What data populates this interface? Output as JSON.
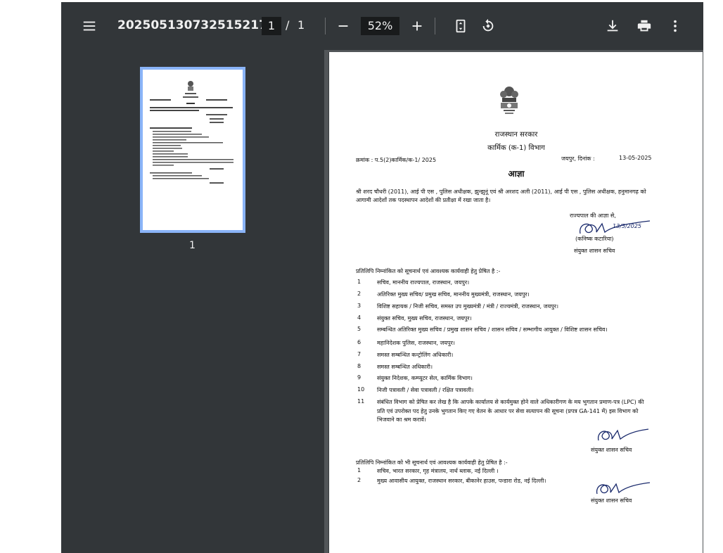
{
  "toolbar": {
    "menu_icon": "hamburger-menu-icon",
    "title": "202505130732515217...",
    "current_page": "1",
    "page_sep": "/",
    "total_pages": "1",
    "zoom": "52%",
    "zoom_out_icon": "minus-icon",
    "zoom_in_icon": "plus-icon",
    "fit_icon": "fit-page-icon",
    "rotate_icon": "rotate-icon",
    "download_icon": "download-icon",
    "print_icon": "print-icon",
    "more_icon": "more-vert-icon",
    "colors": {
      "bar": "#323639",
      "box": "#191b1c",
      "text": "#f1f1f1"
    }
  },
  "sidebar": {
    "thumbnails": [
      {
        "label": "1",
        "selected": true
      }
    ],
    "accent": "#8ab4f8"
  },
  "document": {
    "header_gov": "राजस्थान सरकार",
    "header_dept": "कार्मिक (क-1) विभाग",
    "ref_no": "क्रमांक : प.5(2)कार्मिक/क-1/ 2025",
    "place_date_label": "जयपुर, दिनांक :",
    "date": "13-05-2025",
    "order_title": "आज्ञा",
    "body_line1": "श्री शरद चौधरी (2011), आई पी एस , पुलिस अधीक्षक, झुन्झुनूं एवं श्री अरशद अली (2011), आई पी एस , पुलिस अधीक्षक, हनुमानगढ़ को",
    "body_line2": "आगामी आदेशों तक पदस्थापन आदेशों की प्रतीक्षा में रखा जाता है।",
    "governor_order": "राज्यपाल की आज्ञा से,",
    "signer_name": "(कनिष्क कटारिया)",
    "signer_title": "संयुक्त शासन सचिव",
    "signature_date": "13/5/2025",
    "copy_intro": "प्रतिलिपि निम्नांकित को सूचनार्थ एवं आवश्यक कार्यवाही हेतु प्रेषित है :-",
    "copy_list": [
      {
        "n": "1",
        "text": "सचिव, माननीय राज्यपाल, राजस्थान, जयपुर।"
      },
      {
        "n": "2",
        "text": "अतिरिक्त मुख्य सचिव/ प्रमुख सचिव, माननीय मुख्यमंत्री, राजस्थान, जयपुर।"
      },
      {
        "n": "3",
        "text": "विशिष्ट सहायक / निजी सचिव, समस्त उप मुख्यमंत्री / मंत्री / राज्यमंत्री, राजस्थान, जयपुर।"
      },
      {
        "n": "4",
        "text": "संयुक्त सचिव, मुख्य सचिव, राजस्थान, जयपुर।"
      },
      {
        "n": "5",
        "text": "सम्बन्धित अतिरिक्त मुख्य सचिव / प्रमुख शासन सचिव / शासन सचिव / सम्भागीय आयुक्त / विशिष्ट शासन सचिव।"
      },
      {
        "n": "6",
        "text": "महानिदेशक पुलिस, राजस्थान, जयपुर।"
      },
      {
        "n": "7",
        "text": "समस्त सम्बन्धित कन्ट्रोलिंग अधिकारी।"
      },
      {
        "n": "8",
        "text": "समस्त सम्बन्धित अधिकारी।"
      },
      {
        "n": "9",
        "text": "संयुक्त निदेशक, कम्प्यूटर सेल, कार्मिक विभाग।"
      },
      {
        "n": "10",
        "text": "निजी पत्रावली / सेवा पत्रावली / रक्षित पत्रावली।"
      },
      {
        "n": "11",
        "text": "संबंधित विभाग को प्रेषित कर लेख है कि आपके कार्यालय से कार्यमुक्त होने वाले अधिकारीगण के मय भुगतान प्रमाण-पत्र (LPC) की"
      }
    ],
    "item11_line2": "प्रति एवं उपरोक्त पद हेतु उनके भुगतान किए गए वेतन के आधार पर सेवा सत्यापन की सूचना (प्रपत्र GA-141 में) इस विभाग को",
    "item11_line3": "भिजवाने का श्रम करावें।",
    "sign2_title": "संयुक्त शासन सचिव",
    "copy2_intro": "प्रतिलिपि निम्नांकित को भी सूचनार्थ एवं आवश्यक कार्यवाही हेतु प्रेषित है :-",
    "copy2_list": [
      {
        "n": "1",
        "text": "सचिव, भारत सरकार, गृह मंत्रालय, नार्थ ब्लाक, नई दिल्ली ।"
      },
      {
        "n": "2",
        "text": "मुख्य आवासीय आयुक्त, राजस्थान सरकार, बीकानेर हाउस, पन्डारा रोड, नई दिल्ली।"
      }
    ],
    "sign3_title": "संयुक्त शासन सचिव"
  }
}
